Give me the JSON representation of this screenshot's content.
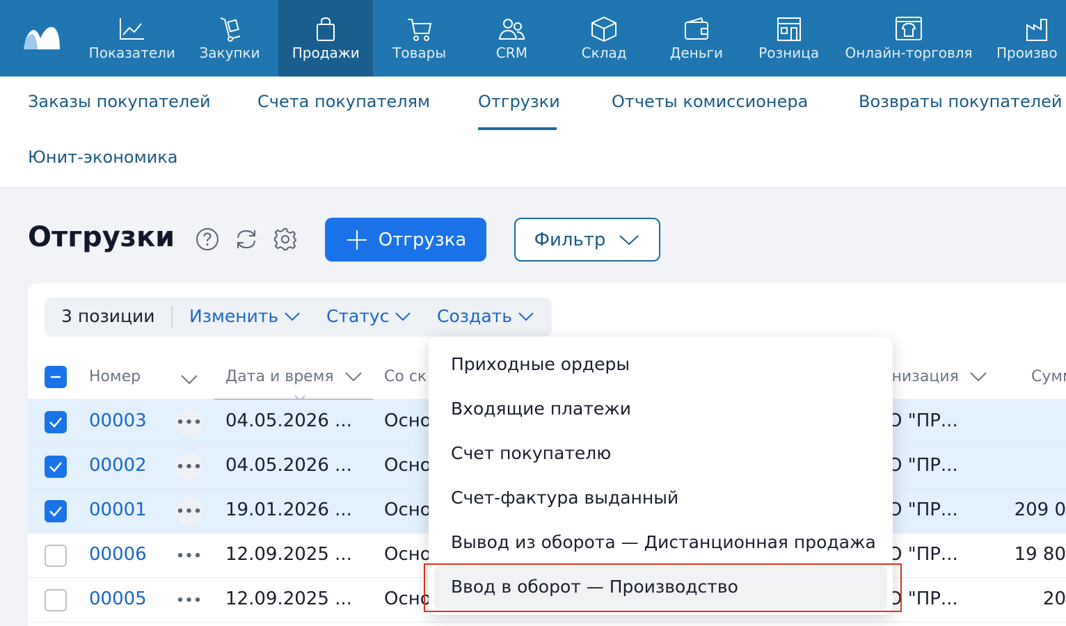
{
  "nav": {
    "items": [
      {
        "label": "Показатели",
        "icon": "chart-line-icon"
      },
      {
        "label": "Закупки",
        "icon": "hand-truck-icon"
      },
      {
        "label": "Продажи",
        "icon": "shopping-bag-icon",
        "active": true
      },
      {
        "label": "Товары",
        "icon": "cart-icon"
      },
      {
        "label": "CRM",
        "icon": "people-icon"
      },
      {
        "label": "Склад",
        "icon": "box-icon"
      },
      {
        "label": "Деньги",
        "icon": "wallet-icon"
      },
      {
        "label": "Розница",
        "icon": "storefront-icon"
      },
      {
        "label": "Онлайн-торговля",
        "icon": "online-shop-icon"
      },
      {
        "label": "Произво",
        "icon": "factory-icon"
      }
    ]
  },
  "subnav": {
    "items": [
      "Заказы покупателей",
      "Счета покупателям",
      "Отгрузки",
      "Отчеты комиссионера",
      "Возвраты покупателей",
      "Юнит-экономика"
    ],
    "active_index": 2
  },
  "page": {
    "title": "Отгрузки",
    "create_button": "Отгрузка",
    "filter_button": "Фильтр"
  },
  "toolbar": {
    "selected_count": "3 позиции",
    "edit": "Изменить",
    "status": "Статус",
    "create": "Создать"
  },
  "table": {
    "columns": [
      "Номер",
      "Дата и время",
      "Со ск",
      "анизация",
      "Сумм"
    ],
    "rows": [
      {
        "checked": true,
        "number": "00003",
        "datetime": "04.05.2026  ...",
        "warehouse": "Осно",
        "org": "О \"ПР...",
        "sum": ""
      },
      {
        "checked": true,
        "number": "00002",
        "datetime": "04.05.2026  ...",
        "warehouse": "Осно",
        "org": "О \"ПР...",
        "sum": ""
      },
      {
        "checked": true,
        "number": "00001",
        "datetime": "19.01.2026  ...",
        "warehouse": "Осно",
        "org": "О \"ПР...",
        "sum": "209 0"
      },
      {
        "checked": false,
        "number": "00006",
        "datetime": "12.09.2025  ...",
        "warehouse": "Осно",
        "org": "О \"ПР...",
        "sum": "19 80"
      },
      {
        "checked": false,
        "number": "00005",
        "datetime": "12.09.2025  ...",
        "warehouse": "Осно",
        "org": "О \"ПР...",
        "sum": "20"
      }
    ]
  },
  "dropdown": {
    "items": [
      "Приходные ордеры",
      "Входящие платежи",
      "Счет покупателю",
      "Счет-фактура выданный",
      "Вывод из оборота — Дистанционная продажа",
      "Ввод в оборот — Производство"
    ],
    "highlighted_index": 5
  },
  "colors": {
    "nav_bg": "#1f76b0",
    "nav_active": "#1a5e8e",
    "accent": "#1a73e8",
    "link": "#1a66c8",
    "selected_row": "#e3f0fd",
    "highlight_box": "#e0321e"
  }
}
